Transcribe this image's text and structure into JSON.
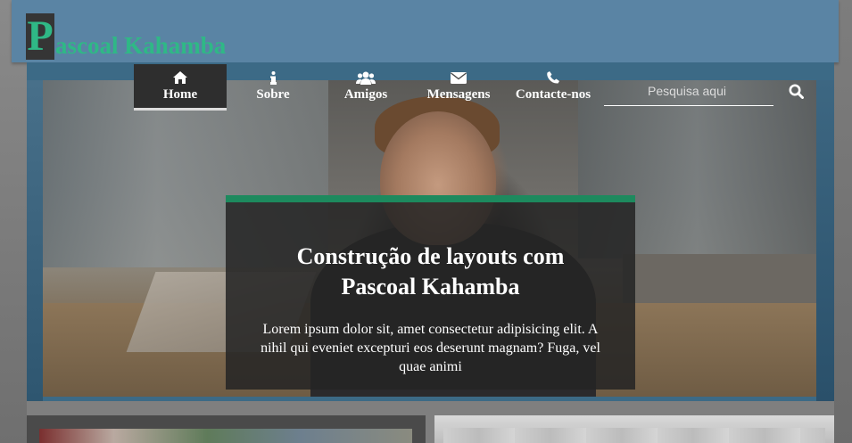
{
  "header": {
    "logo_initial": "P",
    "logo_rest": "ascoal Kahamba"
  },
  "nav": {
    "items": [
      {
        "label": "Home",
        "icon": "home-icon",
        "active": true
      },
      {
        "label": "Sobre",
        "icon": "info-icon",
        "active": false
      },
      {
        "label": "Amigos",
        "icon": "users-icon",
        "active": false
      },
      {
        "label": "Mensagens",
        "icon": "envelope-icon",
        "active": false
      },
      {
        "label": "Contacte-nos",
        "icon": "phone-icon",
        "active": false
      }
    ],
    "search": {
      "placeholder": "Pesquisa aqui",
      "icon": "search-icon"
    }
  },
  "hero": {
    "title": "Construção de layouts com Pascoal Kahamba",
    "text": "Lorem ipsum dolor sit, amet consectetur adipisicing elit. A nihil qui eveniet excepturi eos deserunt magnam? Fuga, vel quae animi"
  },
  "colors": {
    "header_bg": "#5a84a4",
    "accent_green": "#2fb886",
    "caption_border": "#1d8a5e",
    "active_nav_bg": "#2e2e2e"
  }
}
